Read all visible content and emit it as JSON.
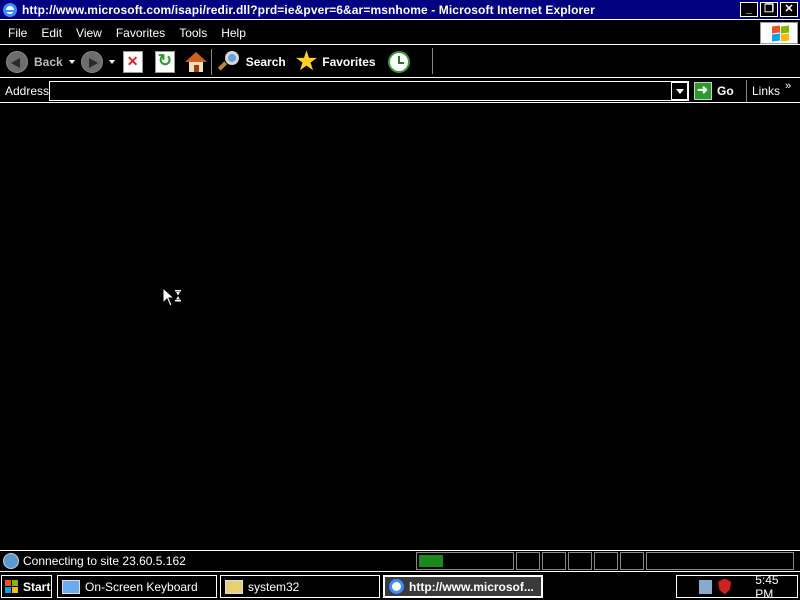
{
  "window": {
    "title": "http://www.microsoft.com/isapi/redir.dll?prd=ie&pver=6&ar=msnhome - Microsoft Internet Explorer",
    "buttons": {
      "minimize": "_",
      "restore": "❐",
      "close": "✕"
    }
  },
  "menu": [
    "File",
    "Edit",
    "View",
    "Favorites",
    "Tools",
    "Help"
  ],
  "toolbar": {
    "back_label": "Back",
    "search_label": "Search",
    "favorites_label": "Favorites"
  },
  "address": {
    "label": "Address",
    "value": "",
    "go_label": "Go",
    "links_label": "Links",
    "links_chevron": "»"
  },
  "status": {
    "text": "Connecting to site 23.60.5.162",
    "progress": 0.25
  },
  "taskbar": {
    "start_label": "Start",
    "tasks": [
      "On-Screen Keyboard",
      "system32",
      "http://www.microsof..."
    ],
    "clock": "5:45 PM"
  },
  "icons": [
    "ie-icon",
    "windows-logo-icon",
    "back-icon",
    "forward-icon",
    "stop-icon",
    "refresh-icon",
    "home-icon",
    "search-icon",
    "favorites-star-icon",
    "history-icon",
    "go-arrow-icon",
    "busy-cursor-icon",
    "network-icon",
    "shield-icon"
  ]
}
